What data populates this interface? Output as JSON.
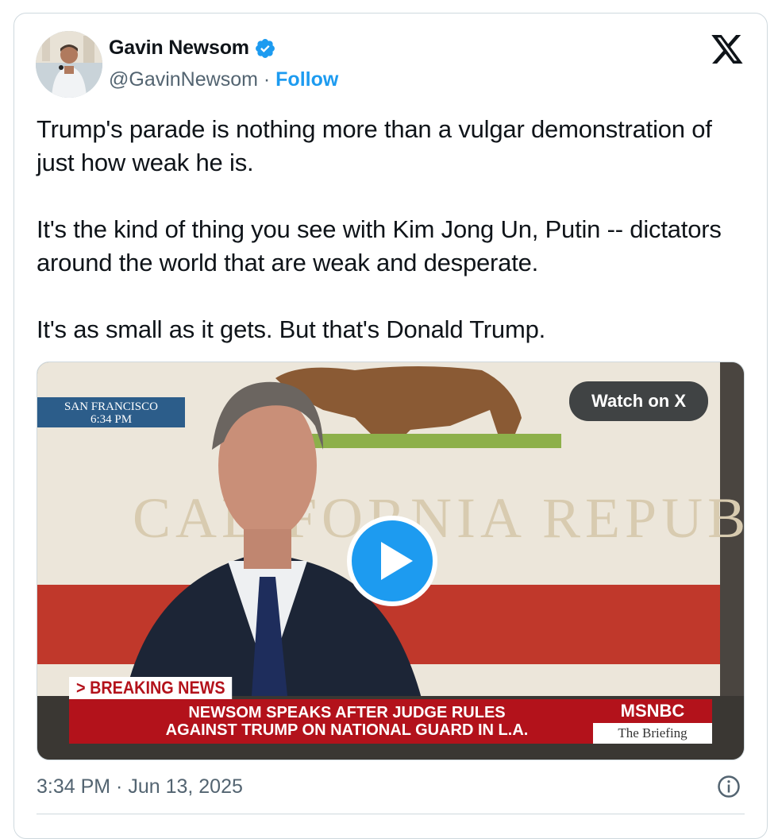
{
  "author": {
    "name": "Gavin Newsom",
    "handle": "@GavinNewsom",
    "separator": " · ",
    "follow_label": "Follow",
    "verified_icon": "verified-badge-icon"
  },
  "tweet": {
    "paragraphs": [
      "Trump's parade is nothing more than a vulgar demonstration of just how weak he is.",
      "It's the kind of thing you see with Kim Jong Un, Putin -- dictators around the world that are weak and desperate.",
      "It's as small as it gets. But that's Donald Trump."
    ]
  },
  "media": {
    "watch_label": "Watch on X",
    "location_line1": "SAN FRANCISCO",
    "location_line2": "6:34 PM",
    "flag_text": "CALIFORNIA REPUBLIC",
    "breaking": "> BREAKING NEWS",
    "headline_line1": "NEWSOM SPEAKS AFTER JUDGE RULES",
    "headline_line2": "AGAINST TRUMP ON NATIONAL GUARD IN L.A.",
    "network": "MSNBC",
    "show": "The Briefing"
  },
  "timestamp": "3:34 PM · Jun 13, 2025",
  "colors": {
    "accent": "#1d9bf0",
    "text": "#0f1419",
    "muted": "#536471",
    "chyron_red": "#b3121b"
  }
}
